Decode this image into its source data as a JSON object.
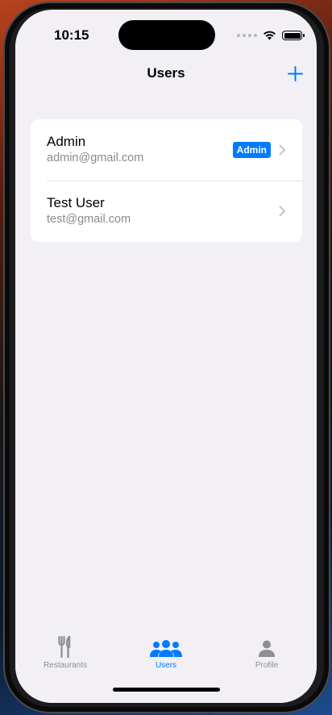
{
  "status_bar": {
    "time": "10:15"
  },
  "nav": {
    "title": "Users"
  },
  "users": [
    {
      "name": "Admin",
      "email": "admin@gmail.com",
      "badge": "Admin"
    },
    {
      "name": "Test User",
      "email": "test@gmail.com",
      "badge": ""
    }
  ],
  "tabs": [
    {
      "label": "Restaurants",
      "icon": "fork-knife-icon",
      "active": false
    },
    {
      "label": "Users",
      "icon": "people-icon",
      "active": true
    },
    {
      "label": "Profile",
      "icon": "person-icon",
      "active": false
    }
  ],
  "colors": {
    "accent": "#007aff",
    "inactive": "#8e8e93",
    "background": "#f2f0f5"
  }
}
